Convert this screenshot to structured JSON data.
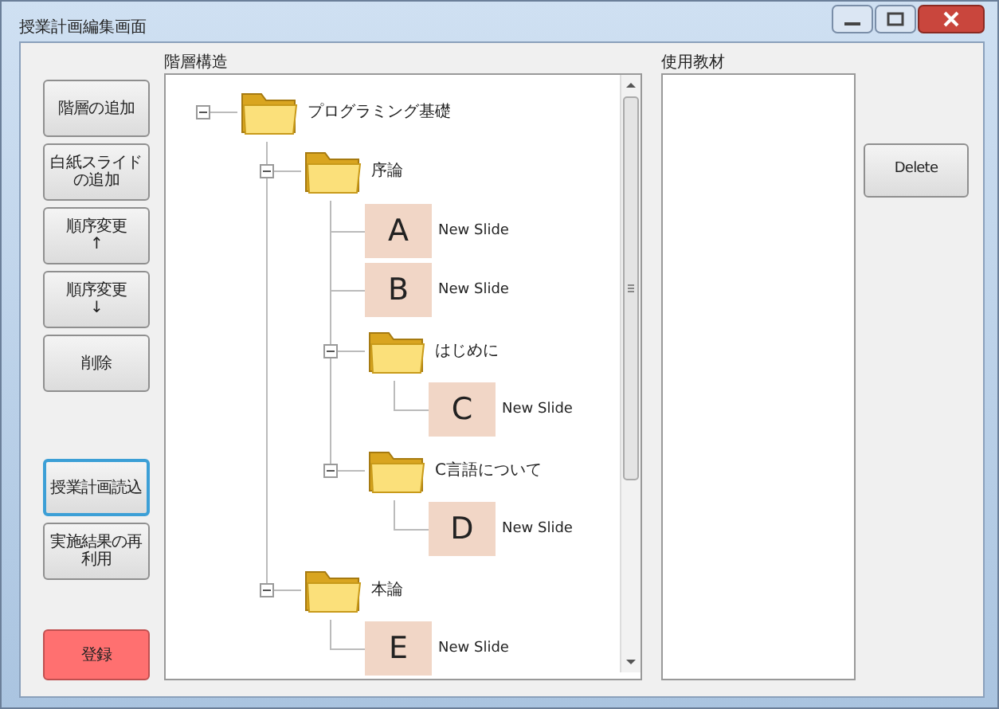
{
  "window": {
    "title": "授業計画編集画面"
  },
  "left_buttons": [
    {
      "label": "階層の追加",
      "kind": "normal"
    },
    {
      "label": "白紙スライドの追加",
      "kind": "normal"
    },
    {
      "label": "順序変更\n↑",
      "kind": "normal"
    },
    {
      "label": "順序変更\n↓",
      "kind": "normal"
    },
    {
      "label": "削除",
      "kind": "normal"
    },
    {
      "label": "授業計画読込",
      "kind": "focused"
    },
    {
      "label": "実施結果の再利用",
      "kind": "normal"
    },
    {
      "label": "登録",
      "kind": "danger"
    }
  ],
  "tree": {
    "label": "階層構造",
    "nodes": [
      {
        "kind": "folder",
        "label": "プログラミング基礎",
        "expanded": true,
        "children": [
          {
            "kind": "folder",
            "label": "序論",
            "expanded": true,
            "children": [
              {
                "kind": "slide",
                "letter": "A",
                "label": "New Slide"
              },
              {
                "kind": "slide",
                "letter": "B",
                "label": "New Slide"
              },
              {
                "kind": "folder",
                "label": "はじめに",
                "expanded": true,
                "children": [
                  {
                    "kind": "slide",
                    "letter": "C",
                    "label": "New Slide"
                  }
                ]
              },
              {
                "kind": "folder",
                "label": "C言語について",
                "expanded": true,
                "children": [
                  {
                    "kind": "slide",
                    "letter": "D",
                    "label": "New Slide"
                  }
                ]
              }
            ]
          },
          {
            "kind": "folder",
            "label": "本論",
            "expanded": true,
            "children": [
              {
                "kind": "slide",
                "letter": "E",
                "label": "New Slide"
              }
            ]
          }
        ]
      }
    ]
  },
  "materials": {
    "label": "使用教材"
  },
  "delete_button": {
    "label": "Delete"
  }
}
